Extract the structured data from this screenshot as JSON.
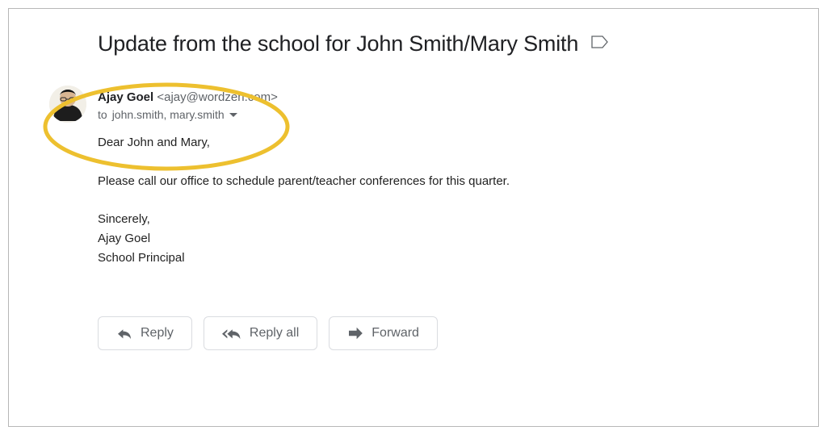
{
  "subject": "Update from the school for John Smith/Mary Smith",
  "sender": {
    "name": "Ajay Goel",
    "email": "<ajay@wordzen.com>"
  },
  "recipients": {
    "to_prefix": "to",
    "list": "john.smith, mary.smith"
  },
  "body": {
    "salutation": "Dear John and Mary,",
    "paragraph": "Please call our office to schedule parent/teacher conferences for this quarter.",
    "closing": "Sincerely,",
    "sig_name": "Ajay Goel",
    "sig_title": "School Principal"
  },
  "actions": {
    "reply": "Reply",
    "reply_all": "Reply all",
    "forward": "Forward"
  }
}
